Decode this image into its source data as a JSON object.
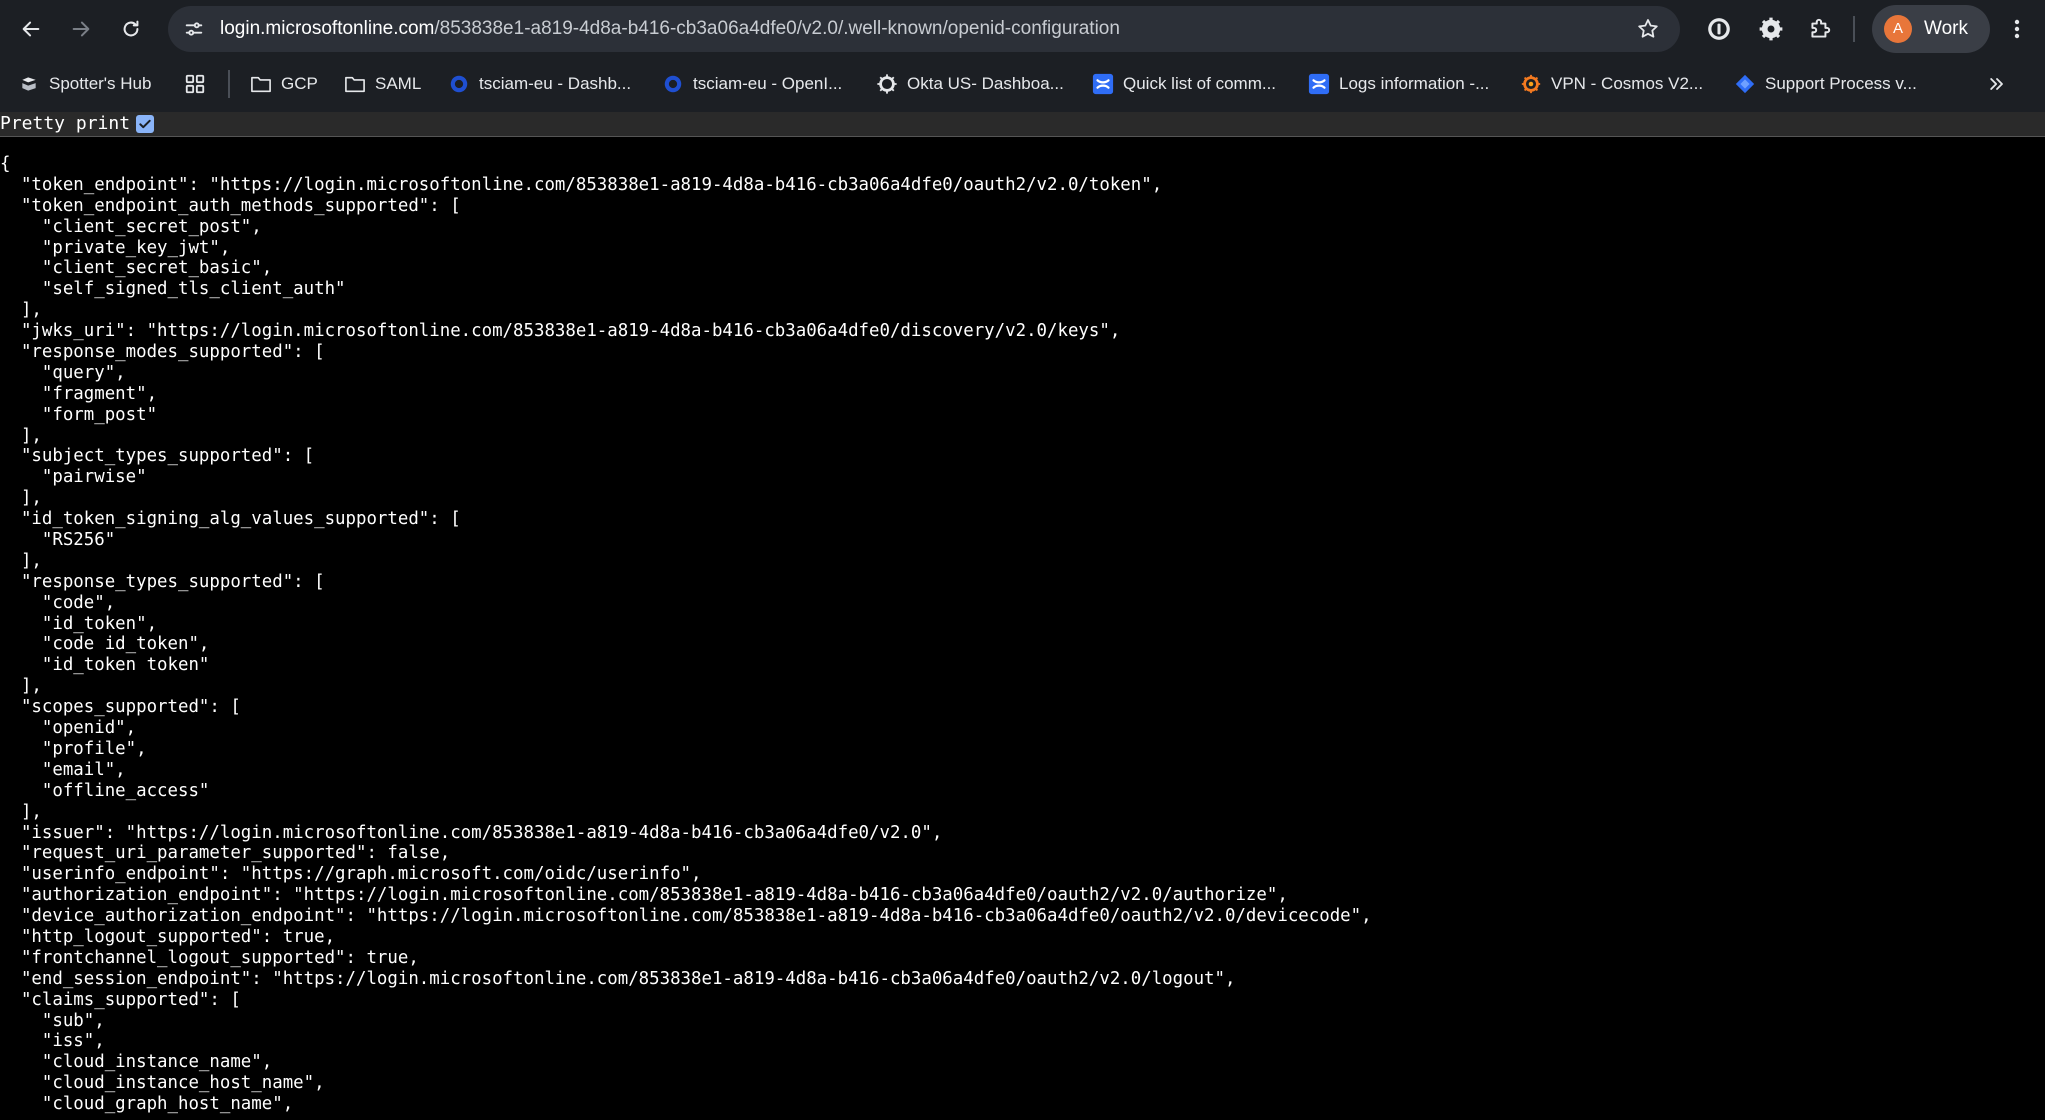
{
  "browser": {
    "url_host": "login.microsoftonline.com",
    "url_path": "/853838e1-a819-4d8a-b416-cb3a06a4dfe0/v2.0/.well-known/openid-configuration",
    "profile_initial": "A",
    "profile_label": "Work"
  },
  "bookmarks": [
    {
      "label": "Spotter's Hub",
      "icon": "bookmark-doc-icon"
    },
    {
      "label": "",
      "icon": "apps-grid-icon"
    },
    {
      "label": "GCP",
      "icon": "folder-icon"
    },
    {
      "label": "SAML",
      "icon": "folder-icon"
    },
    {
      "label": "tsciam-eu - Dashb...",
      "icon": "okta-icon"
    },
    {
      "label": "tsciam-eu - OpenI...",
      "icon": "okta-icon"
    },
    {
      "label": "Okta US- Dashboa...",
      "icon": "okta-gear-icon"
    },
    {
      "label": "Quick list of comm...",
      "icon": "confluence-icon"
    },
    {
      "label": "Logs information -...",
      "icon": "confluence-icon"
    },
    {
      "label": "VPN - Cosmos V2...",
      "icon": "grafana-icon"
    },
    {
      "label": "Support Process v...",
      "icon": "jira-icon"
    }
  ],
  "pretty_print": {
    "label": "Pretty print",
    "checked": true
  },
  "json_lines": [
    "{",
    "  \"token_endpoint\": \"https://login.microsoftonline.com/853838e1-a819-4d8a-b416-cb3a06a4dfe0/oauth2/v2.0/token\",",
    "  \"token_endpoint_auth_methods_supported\": [",
    "    \"client_secret_post\",",
    "    \"private_key_jwt\",",
    "    \"client_secret_basic\",",
    "    \"self_signed_tls_client_auth\"",
    "  ],",
    "  \"jwks_uri\": \"https://login.microsoftonline.com/853838e1-a819-4d8a-b416-cb3a06a4dfe0/discovery/v2.0/keys\",",
    "  \"response_modes_supported\": [",
    "    \"query\",",
    "    \"fragment\",",
    "    \"form_post\"",
    "  ],",
    "  \"subject_types_supported\": [",
    "    \"pairwise\"",
    "  ],",
    "  \"id_token_signing_alg_values_supported\": [",
    "    \"RS256\"",
    "  ],",
    "  \"response_types_supported\": [",
    "    \"code\",",
    "    \"id_token\",",
    "    \"code id_token\",",
    "    \"id_token token\"",
    "  ],",
    "  \"scopes_supported\": [",
    "    \"openid\",",
    "    \"profile\",",
    "    \"email\",",
    "    \"offline_access\"",
    "  ],",
    "  \"issuer\": \"https://login.microsoftonline.com/853838e1-a819-4d8a-b416-cb3a06a4dfe0/v2.0\",",
    "  \"request_uri_parameter_supported\": false,",
    "  \"userinfo_endpoint\": \"https://graph.microsoft.com/oidc/userinfo\",",
    "  \"authorization_endpoint\": \"https://login.microsoftonline.com/853838e1-a819-4d8a-b416-cb3a06a4dfe0/oauth2/v2.0/authorize\",",
    "  \"device_authorization_endpoint\": \"https://login.microsoftonline.com/853838e1-a819-4d8a-b416-cb3a06a4dfe0/oauth2/v2.0/devicecode\",",
    "  \"http_logout_supported\": true,",
    "  \"frontchannel_logout_supported\": true,",
    "  \"end_session_endpoint\": \"https://login.microsoftonline.com/853838e1-a819-4d8a-b416-cb3a06a4dfe0/oauth2/v2.0/logout\",",
    "  \"claims_supported\": [",
    "    \"sub\",",
    "    \"iss\",",
    "    \"cloud_instance_name\",",
    "    \"cloud_instance_host_name\",",
    "    \"cloud_graph_host_name\","
  ]
}
